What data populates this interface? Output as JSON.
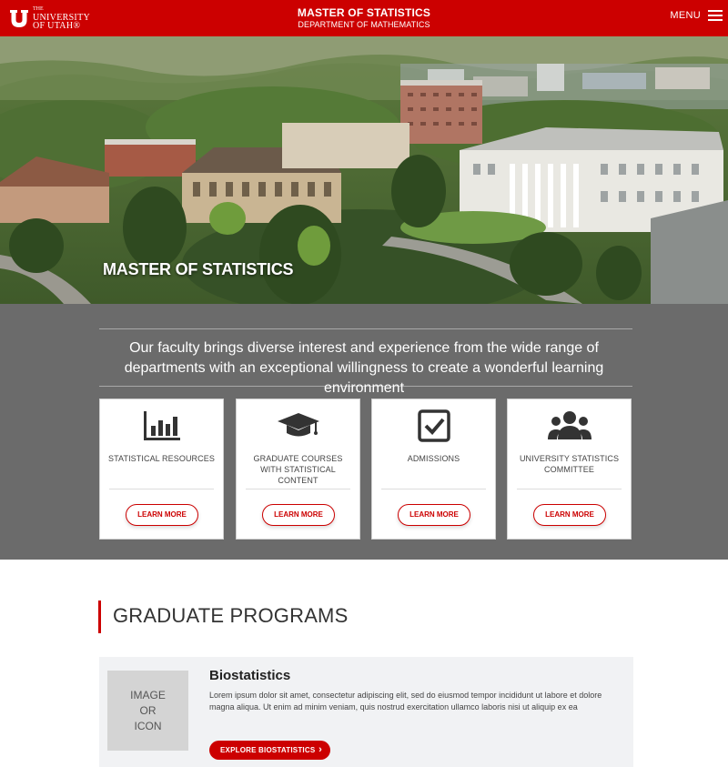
{
  "header": {
    "logo_the": "THE",
    "logo_line1": "UNIVERSITY",
    "logo_line2": "OF UTAH®",
    "title": "MASTER OF STATISTICS",
    "subtitle": "DEPARTMENT OF MATHEMATICS",
    "menu_label": "MENU"
  },
  "hero": {
    "title": "MASTER OF STATISTICS"
  },
  "intro": {
    "tagline": "Our faculty brings diverse interest and experience from the wide range of departments with an exceptional willingness to create a wonderful learning environment"
  },
  "cards": [
    {
      "icon": "bar-chart-icon",
      "label": "STATISTICAL RESOURCES",
      "button": "LEARN MORE"
    },
    {
      "icon": "graduation-cap-icon",
      "label": "GRADUATE COURSES WITH STATISTICAL CONTENT",
      "button": "LEARN MORE"
    },
    {
      "icon": "checkbox-icon",
      "label": "ADMISSIONS",
      "button": "LEARN MORE"
    },
    {
      "icon": "users-icon",
      "label": "UNIVERSITY STATISTICS COMMITTEE",
      "button": "LEARN MORE"
    }
  ],
  "programs": {
    "heading": "GRADUATE PROGRAMS",
    "items": [
      {
        "placeholder_line1": "IMAGE",
        "placeholder_line2": "OR",
        "placeholder_line3": "ICON",
        "title": "Biostatistics",
        "description": "Lorem ipsum dolor sit amet, consectetur adipiscing elit, sed do eiusmod tempor incididunt ut labore et dolore magna aliqua. Ut enim ad minim veniam, quis nostrud exercitation ullamco laboris nisi ut aliquip ex ea",
        "button": "EXPLORE BIOSTATISTICS",
        "button_icon": "chevron-right-icon"
      }
    ]
  },
  "colors": {
    "brand_red": "#cc0000",
    "band_gray": "#6b6b6b",
    "program_bg": "#f1f2f4"
  }
}
